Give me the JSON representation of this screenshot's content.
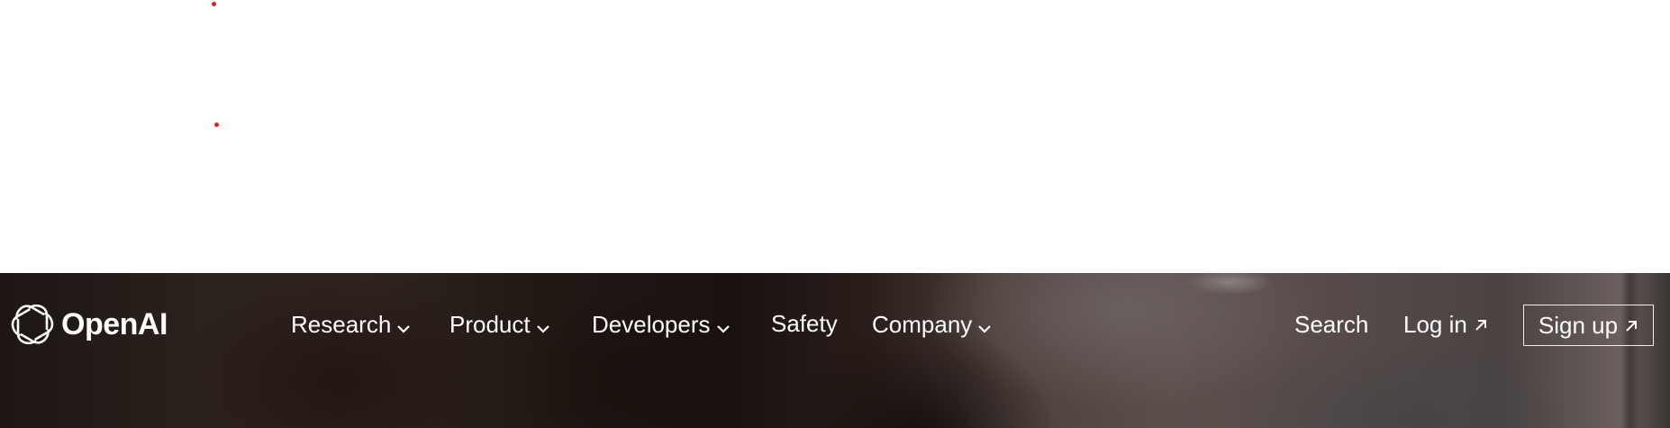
{
  "brand": {
    "name": "OpenAI"
  },
  "nav": {
    "menu": [
      {
        "label": "Research",
        "has_dropdown": true
      },
      {
        "label": "Product",
        "has_dropdown": true
      },
      {
        "label": "Developers",
        "has_dropdown": true
      },
      {
        "label": "Safety",
        "has_dropdown": false
      },
      {
        "label": "Company",
        "has_dropdown": true
      }
    ],
    "search_label": "Search",
    "login_label": "Log in",
    "signup_label": "Sign up"
  },
  "icons": {
    "logo": "openai-logo-icon",
    "dropdown": "chevron-down-icon",
    "external": "arrow-up-right-icon"
  },
  "colors": {
    "nav_text": "#ffffff",
    "dot": "#e02020",
    "page_bg": "#ffffff"
  }
}
